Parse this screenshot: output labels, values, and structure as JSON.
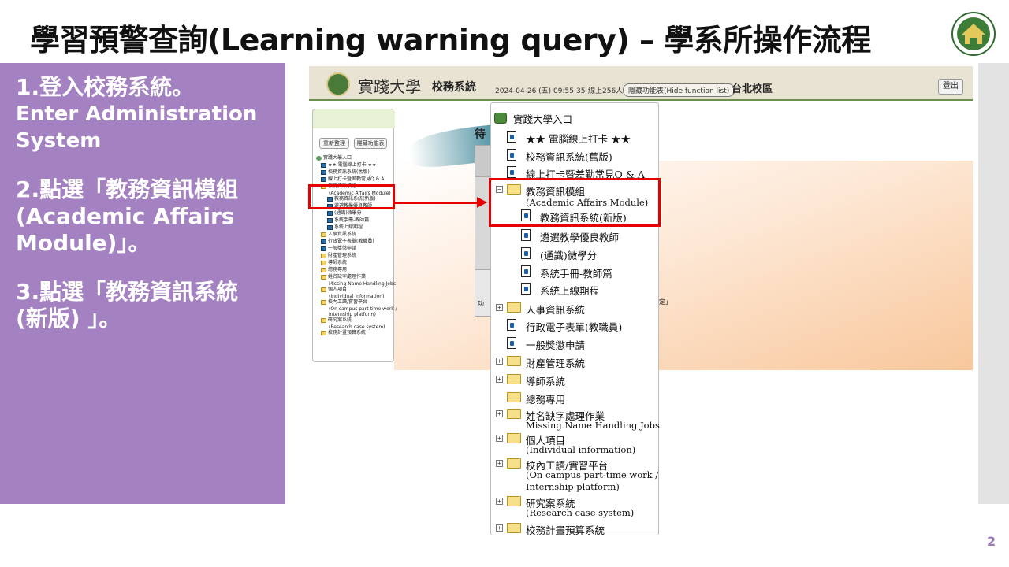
{
  "slide": {
    "title": "學習預警查詢(Learning warning query) – 學系所操作流程",
    "page_number": "2"
  },
  "steps": [
    {
      "zh": "1.登入校務系統。",
      "en": "Enter Administration System"
    },
    {
      "zh": "2.點選「教務資訊模組(Academic Affairs Module)」。",
      "en": ""
    },
    {
      "zh": "3.點選「教務資訊系統(新版) 」。",
      "en": ""
    }
  ],
  "system": {
    "university": "實踐大學",
    "name": "校務系統",
    "date": "2024-04-26 (五) 09:55:35",
    "users": "線上256人",
    "hide_function": "隱藏功能表(Hide function list)",
    "campus": "台北校區",
    "logout": "登出",
    "bg_text_1": "待",
    "bg_text_2": "設定」",
    "bg_text_3": "功"
  },
  "small_sidebar": {
    "btn_refresh": "重新整理",
    "btn_hide": "隱藏功能表",
    "items": [
      "實踐大學入口",
      "★★ 電腦線上打卡 ★★",
      "校務資訊系統(舊版)",
      "線上打卡暨差勤常見Q & A",
      "教務資訊模組",
      "(Academic Affairs Module)",
      "教務資訊系統(新版)",
      "遴選教學優良教師",
      "(通識)微學分",
      "系統手冊-教師篇",
      "系統上線期程",
      "人事資訊系統",
      "行政電子表單(教職員)",
      "一般獎懲申請",
      "財產管理系統",
      "導師系統",
      "總務專用",
      "姓名缺字處理作業",
      "Missing Name Handling Jobs",
      "個人項目",
      "(Individual information)",
      "校內工讀/實習平台",
      "(On campus part-time work /",
      "Internship platform)",
      "研究案系統",
      "(Research case system)",
      "校務計畫預算系統"
    ]
  },
  "tree": {
    "root": "實踐大學入口",
    "clock": "★★ 電腦線上打卡 ★★",
    "old_system": "校務資訊系統(舊版)",
    "qa": "線上打卡暨差勤常見Q & A",
    "academic_module": "教務資訊模組",
    "academic_module_en": "(Academic Affairs Module)",
    "academic_new": "教務資訊系統(新版)",
    "teacher_select": "遴選教學優良教師",
    "micro_credit": "(通識)微學分",
    "manual": "系統手冊-教師篇",
    "schedule": "系統上線期程",
    "hr": "人事資訊系統",
    "e_form": "行政電子表單(教職員)",
    "reward": "一般獎懲申請",
    "property": "財產管理系統",
    "tutor": "導師系統",
    "general": "總務專用",
    "missing_name": "姓名缺字處理作業",
    "missing_name_en": "Missing Name Handling Jobs",
    "personal": "個人項目",
    "personal_en": "(Individual information)",
    "work": "校內工讀/實習平台",
    "work_en_1": "(On campus part-time work /",
    "work_en_2": "Internship platform)",
    "research": "研究案系統",
    "research_en": "(Research case system)",
    "budget": "校務計畫預算系統"
  },
  "colors": {
    "panel": "#a482c2",
    "highlight": "#e40000",
    "header": "#e8e3d2"
  }
}
